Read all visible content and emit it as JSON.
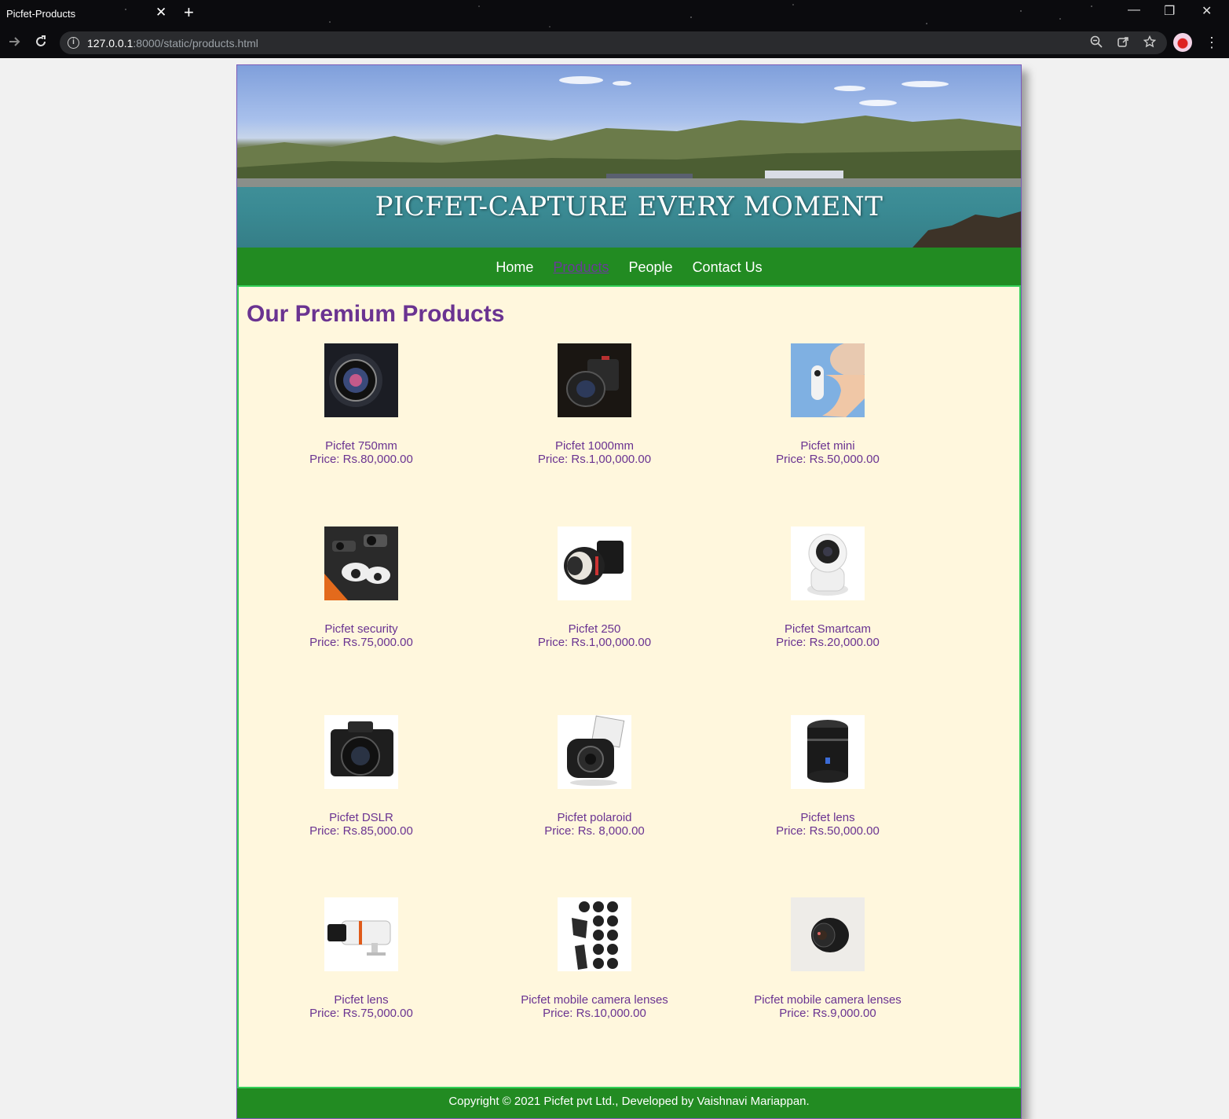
{
  "browser": {
    "tab_title": "Picfet-Products",
    "tab_close": "✕",
    "new_tab": "+",
    "url_host": "127.0.0.1",
    "url_path": ":8000/static/products.html",
    "minimize": "—",
    "restore": "❐",
    "close": "✕"
  },
  "site": {
    "banner_title": "PICFET-CAPTURE EVERY MOMENT",
    "nav": [
      {
        "label": "Home"
      },
      {
        "label": "Products"
      },
      {
        "label": "People"
      },
      {
        "label": "Contact Us"
      }
    ],
    "active_nav": "Products",
    "heading": "Our Premium Products",
    "products": [
      {
        "name": "Picfet 750mm",
        "price": "Price: Rs.80,000.00"
      },
      {
        "name": "Picfet 1000mm",
        "price": "Price: Rs.1,00,000.00"
      },
      {
        "name": "Picfet mini",
        "price": "Price: Rs.50,000.00"
      },
      {
        "name": "Picfet security",
        "price": "Price: Rs.75,000.00"
      },
      {
        "name": "Picfet 250",
        "price": "Price: Rs.1,00,000.00"
      },
      {
        "name": "Picfet Smartcam",
        "price": "Price: Rs.20,000.00"
      },
      {
        "name": "Picfet DSLR",
        "price": "Price: Rs.85,000.00"
      },
      {
        "name": "Picfet polaroid",
        "price": "Price: Rs. 8,000.00"
      },
      {
        "name": "Picfet lens",
        "price": "Price: Rs.50,000.00"
      },
      {
        "name": "Picfet lens",
        "price": "Price: Rs.75,000.00"
      },
      {
        "name": "Picfet mobile camera lenses",
        "price": "Price: Rs.10,000.00"
      },
      {
        "name": "Picfet mobile camera lenses",
        "price": "Price: Rs.9,000.00"
      }
    ],
    "footer": "Copyright © 2021 Picfet pvt Ltd., Developed by Vaishnavi Mariappan."
  },
  "colors": {
    "nav_green": "#228b22",
    "heading_purple": "#6a3391",
    "content_bg": "#fff7dd"
  }
}
